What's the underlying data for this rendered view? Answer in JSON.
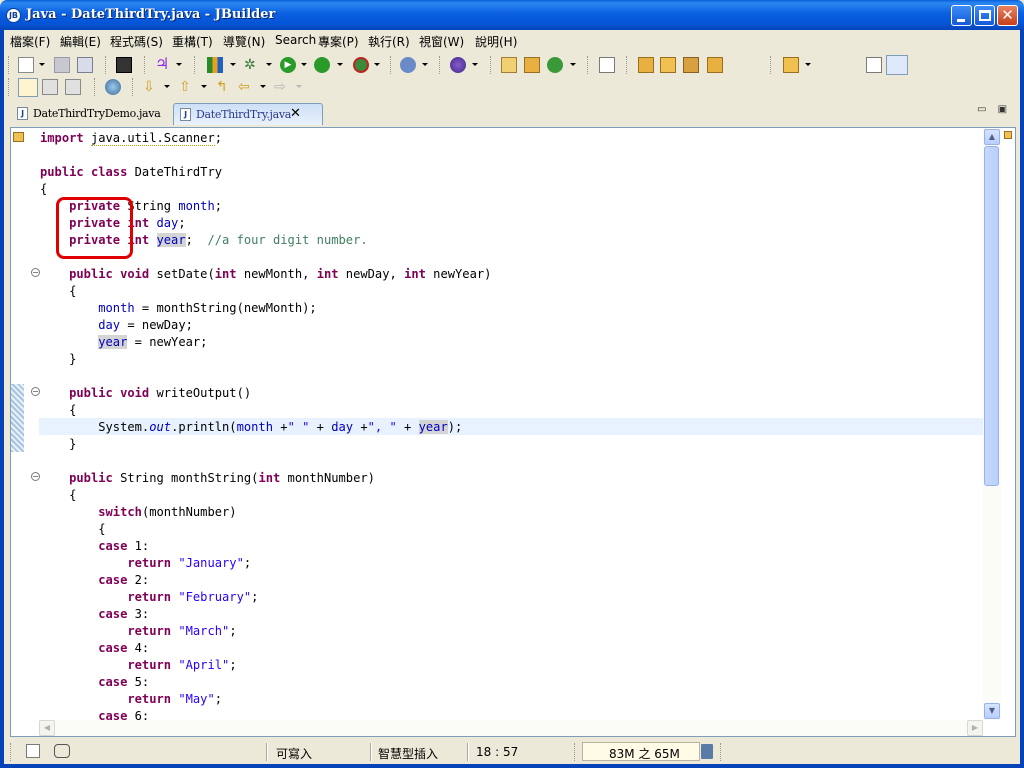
{
  "window": {
    "title": "Java - DateThirdTry.java - JBuilder",
    "app_icon_text": "JB"
  },
  "menu": {
    "items": [
      "檔案(F)",
      "編輯(E)",
      "程式碼(S)",
      "重構(T)",
      "導覽(N)",
      "Search",
      "專案(P)",
      "執行(R)",
      "視窗(W)",
      "說明(H)"
    ]
  },
  "tabs": {
    "items": [
      {
        "label": "DateThirdTryDemo.java",
        "active": false
      },
      {
        "label": "DateThirdTry.java",
        "active": true
      }
    ],
    "close_glyph": "✕"
  },
  "editor": {
    "annotation": "red box around the three 'private' modifiers"
  },
  "statusbar": {
    "writable": "可寫入",
    "insert_mode": "智慧型插入",
    "cursor": "18 : 57",
    "heap": "83M 之 65M"
  },
  "colors": {
    "title_bar": "#0a5fe0",
    "keyword": "#7f0055",
    "string": "#2a00ff",
    "comment": "#3f7f5f",
    "field": "#0000c0",
    "current_line": "#e8f2fe",
    "highlight_box": "#e00000"
  }
}
